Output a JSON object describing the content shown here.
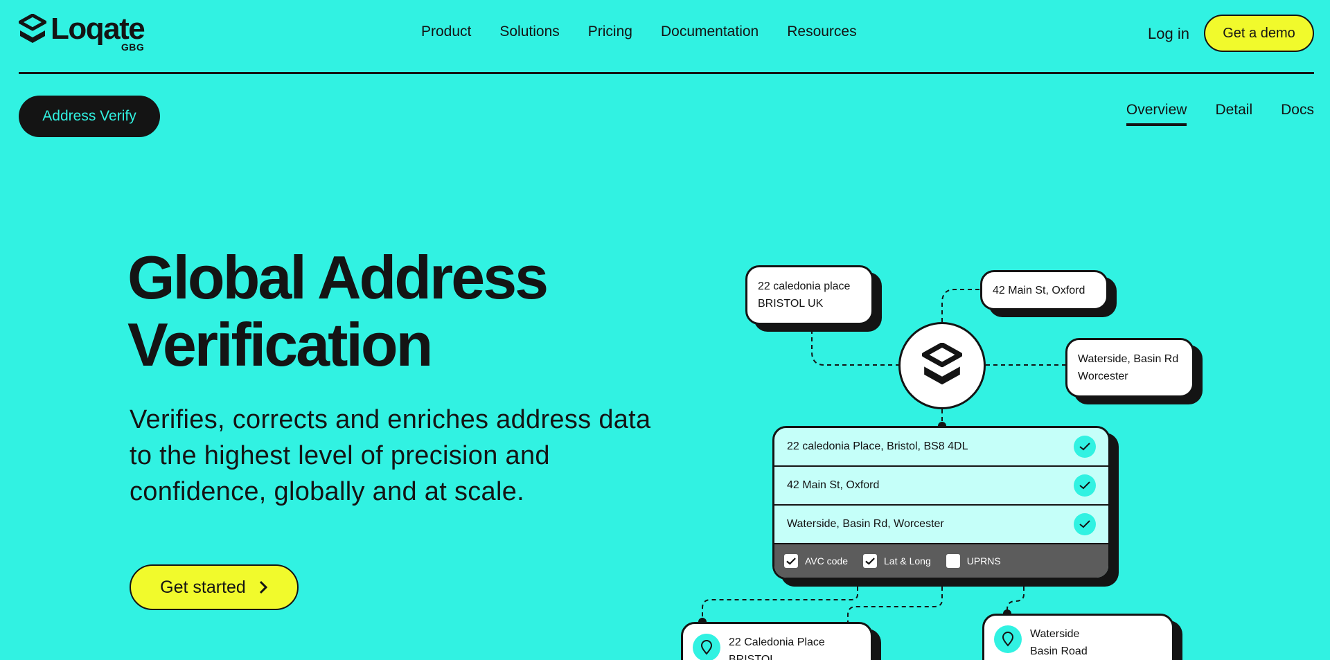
{
  "header": {
    "logo_word": "Loqate",
    "logo_sub": "GBG",
    "nav": [
      "Product",
      "Solutions",
      "Pricing",
      "Documentation",
      "Resources"
    ],
    "login": "Log in",
    "demo": "Get a demo"
  },
  "subnav": {
    "product": "Address Verify",
    "tabs": [
      "Overview",
      "Detail",
      "Docs"
    ],
    "active_tab": "Overview"
  },
  "hero": {
    "title_line1": "Global Address",
    "title_line2": "Verification",
    "description": "Verifies, corrects and enriches address data to the highest level of precision and confidence, globally and at scale.",
    "cta": "Get started"
  },
  "illustration": {
    "input_cards": [
      {
        "line1": "22 caledonia place",
        "line2": "BRISTOL UK"
      },
      {
        "line1": "42 Main St, Oxford",
        "line2": ""
      },
      {
        "line1": "Waterside, Basin Rd",
        "line2": "Worcester"
      }
    ],
    "verified_rows": [
      "22 caledonia Place, Bristol, BS8 4DL",
      "42 Main St, Oxford",
      "Waterside, Basin Rd, Worcester"
    ],
    "options": [
      {
        "label": "AVC code",
        "checked": true
      },
      {
        "label": "Lat & Long",
        "checked": true
      },
      {
        "label": "UPRNS",
        "checked": false
      }
    ],
    "output_cards": [
      {
        "line1": "22 Caledonia Place",
        "line2": "BRISTOL"
      },
      {
        "line1": "Waterside",
        "line2": "Basin Road"
      }
    ]
  },
  "colors": {
    "background": "#31f2e2",
    "accent_yellow": "#f1fa2c",
    "dark": "#141414"
  }
}
